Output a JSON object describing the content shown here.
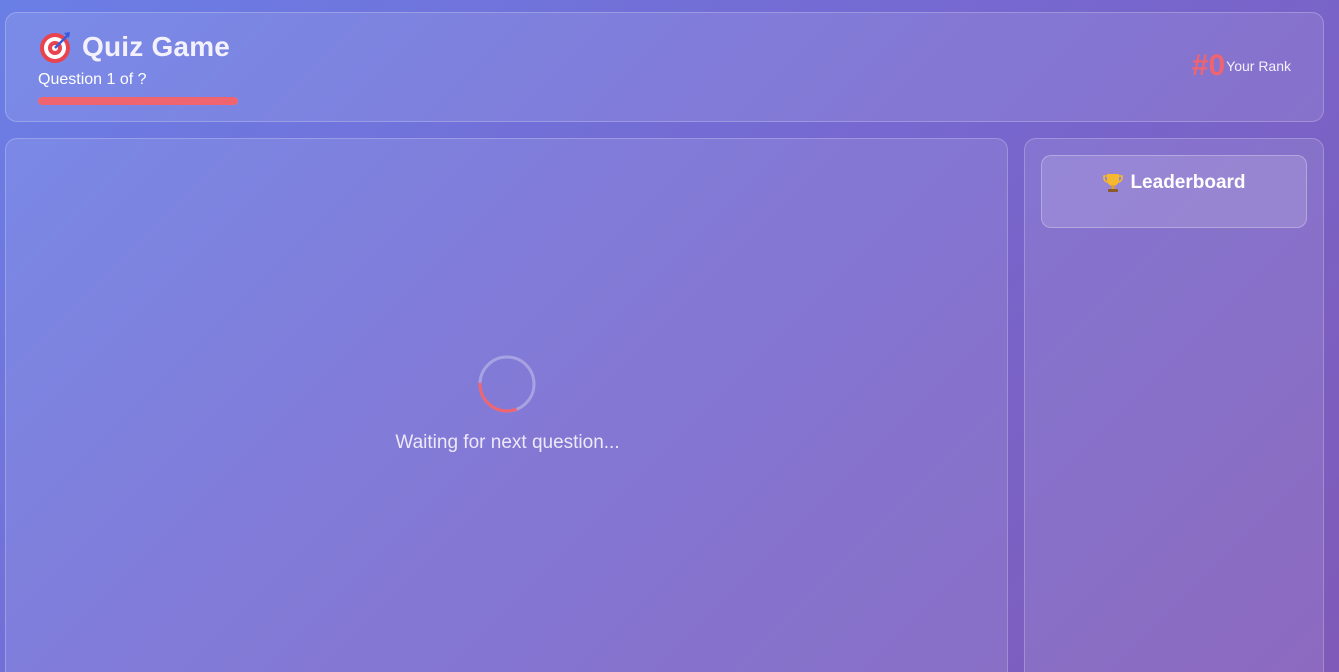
{
  "header": {
    "title": "Quiz Game",
    "title_icon": "target-icon",
    "question_counter": "Question 1 of ?",
    "progress_fraction": 1.0,
    "rank_value": "#0",
    "rank_label": "Your Rank"
  },
  "main": {
    "waiting_text": "Waiting for next question...",
    "spinner_icon": "loading-spinner-icon"
  },
  "leaderboard": {
    "title": "Leaderboard",
    "icon": "trophy-icon"
  },
  "colors": {
    "accent": "#f0646f",
    "background_start": "#6a7fe6",
    "background_end": "#7f5ab8"
  }
}
